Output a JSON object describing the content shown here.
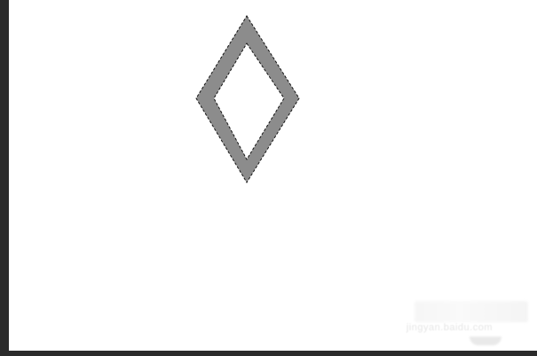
{
  "canvas": {
    "background_color": "#ffffff",
    "frame_color": "#2b2b2b",
    "shape": {
      "type": "diamond-outline",
      "stroke_color": "#8c8c8c",
      "selection_color": "#000000",
      "selection_state": "marching-ants selection"
    }
  },
  "watermark": {
    "text": "jingyan.baidu.com"
  }
}
